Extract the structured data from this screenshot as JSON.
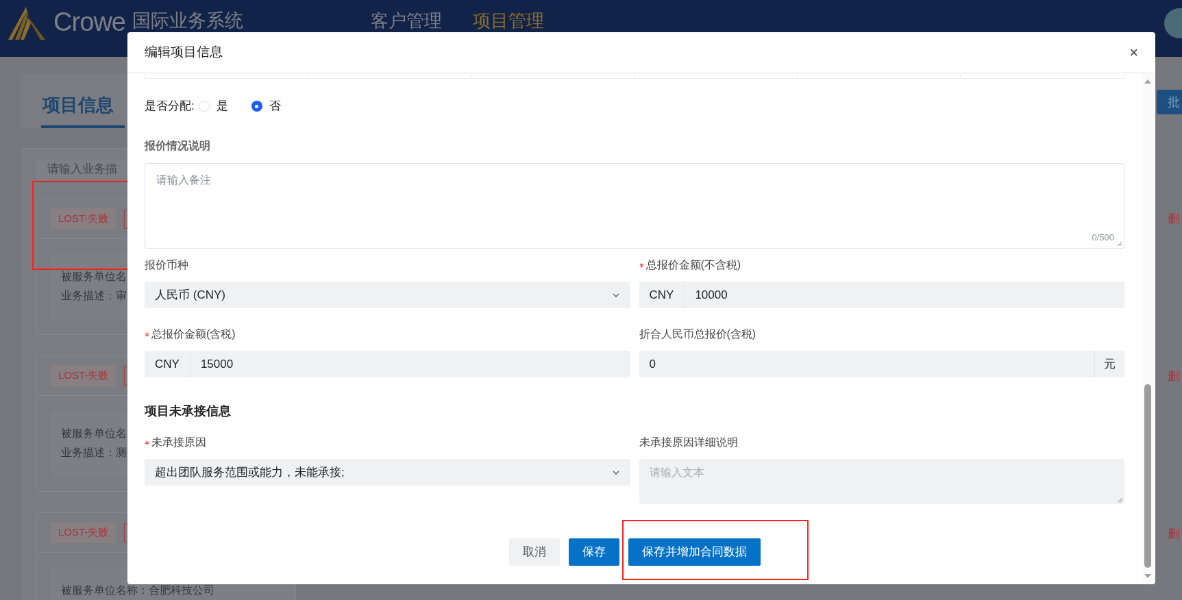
{
  "header": {
    "logo_text": "Crowe",
    "system_name": "国际业务系统",
    "nav": [
      {
        "label": "客户管理",
        "selected": false
      },
      {
        "label": "项目管理",
        "selected": true
      }
    ]
  },
  "background": {
    "tab": "项目信息",
    "search_placeholder": "请输入业务描",
    "batch_button": "批",
    "cards": [
      {
        "status": "LOST-失败",
        "lines": [
          "被服务单位名",
          "业务描述：审"
        ],
        "action": "删"
      },
      {
        "status": "LOST-失败",
        "lines": [
          "被服务单位名",
          "业务描述：测"
        ],
        "action": "删"
      },
      {
        "status": "LOST-失败",
        "lines": [
          "被服务单位名称：合肥科技公司"
        ],
        "action": "删"
      }
    ]
  },
  "dialog": {
    "title": "编辑项目信息",
    "close": "×",
    "allocation": {
      "label": "是否分配:",
      "options": [
        {
          "label": "是",
          "selected": false
        },
        {
          "label": "否",
          "selected": true
        }
      ]
    },
    "quote_note": {
      "label": "报价情况说明",
      "placeholder": "请输入备注",
      "counter": "0/500"
    },
    "fields": [
      {
        "kind": "select",
        "label": "报价币种",
        "required": false,
        "value": "人民币 (CNY)"
      },
      {
        "kind": "prefixed",
        "label": "总报价金额(不含税)",
        "required": true,
        "prefix": "CNY",
        "value": "10000"
      },
      {
        "kind": "prefixed",
        "label": "总报价金额(含税)",
        "required": true,
        "prefix": "CNY",
        "value": "15000"
      },
      {
        "kind": "suffixed",
        "label": "折合人民币总报价(含税)",
        "required": false,
        "value": "0",
        "suffix": "元"
      }
    ],
    "section_title": "项目未承接信息",
    "reason_fields": [
      {
        "kind": "select",
        "label": "未承接原因",
        "required": true,
        "value": "超出团队服务范围或能力，未能承接;"
      },
      {
        "kind": "textarea",
        "label": "未承接原因详细说明",
        "required": false,
        "placeholder": "请输入文本"
      }
    ],
    "buttons": [
      {
        "label": "取消",
        "kind": "secondary"
      },
      {
        "label": "保存",
        "kind": "primary"
      },
      {
        "label": "保存并增加合同数据",
        "kind": "primary"
      }
    ]
  }
}
